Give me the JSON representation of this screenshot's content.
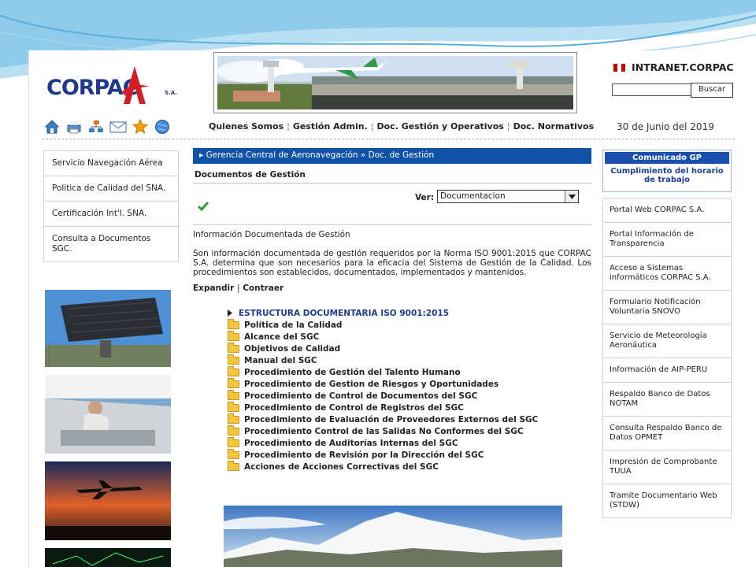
{
  "header": {
    "logo_text": "CORPAC",
    "logo_suffix": "S.A.",
    "intranet_label": "INTRANET.CORPAC",
    "search_placeholder": "",
    "search_button": "Buscar",
    "date": "30 de Junio del 2019"
  },
  "top_nav": [
    "Quienes Somos",
    "Gestión Admin.",
    "Doc. Gestión y Operativos",
    "Doc. Normativos"
  ],
  "nav_separator": "¦",
  "toolbar_icons": [
    "home-icon",
    "printer-icon",
    "sitemap-icon",
    "mail-icon",
    "star-icon",
    "globe-icon"
  ],
  "left_menu": [
    "Servicio Navegación Aérea",
    "Politica de Calidad del SNA.",
    "Certificación Int'l. SNA.",
    "Consulta a Documentos SGC."
  ],
  "breadcrumb": "Gerencia Central de Aeronavegación » Doc. de Gestión",
  "section_title": "Documentos de Gestión",
  "ver": {
    "label": "Ver:",
    "selected": "Documentacion"
  },
  "info": {
    "title": "Información Documentada de Gestión",
    "body": "Son información documentada de gestión requeridos por la Norma ISO 9001:2015 que CORPAC S.A. determina que son necesarios para la eficacia del Sistema de Gestión de la Calidad. Los procedimientos son establecidos, documentados, implementados y mantenidos."
  },
  "expand_label": "Expandir",
  "collapse_label": "Contraer",
  "expand_separator": "|",
  "tree": {
    "root": "ESTRUCTURA DOCUMENTARIA ISO 9001:2015",
    "items": [
      "Política de la Calidad",
      "Alcance del SGC",
      "Objetivos de Calidad",
      "Manual del SGC",
      "Procedimiento de Gestión del Talento Humano",
      "Procedimiento de Gestion de Riesgos y Oportunidades",
      "Procedimiento de Control de Documentos del SGC",
      "Procedimiento de Control de Registros del SGC",
      "Procedimiento de Evaluación de Proveedores Externos del SGC",
      "Procedimiento Control de las Salidas No Conformes del SGC",
      "Procedimiento de Auditorías Internas del SGC",
      "Procedimiento de Revisión por la Dirección del SGC",
      "Acciones de Acciones Correctivas del SGC"
    ]
  },
  "comunicado": {
    "title": "Comunicado GP",
    "body": "Cumplimiento del horario de trabajo"
  },
  "right_menu": [
    "Portal Web CORPAC S.A.",
    "Portal Información de Transparencia",
    "Acceso a Sistemas informáticos CORPAC S.A.",
    "Formulario Notificación Voluntaria SNOVO",
    "Servicio de Meteorología Aeronáutica",
    "Información de AIP-PERU",
    "Respaldo Banco de Datos NOTAM",
    "Consulta Respaldo Banco de Datos OPMET",
    "Impresión de Comprobante TUUA",
    "Tramite Documentario Web (STDW)"
  ],
  "colors": {
    "brand_blue": "#1f3a8a",
    "brand_red": "#d21f26",
    "breadcrumb_bg": "#0f52a8",
    "folder": "#f5c53e"
  }
}
